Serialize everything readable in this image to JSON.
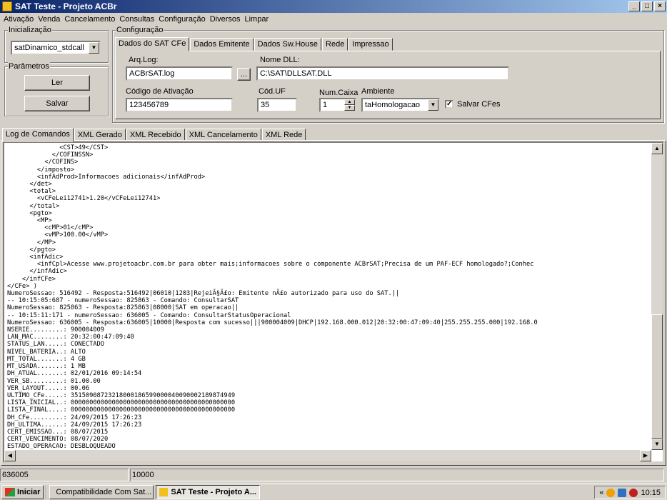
{
  "window": {
    "title": "SAT Teste - Projeto ACBr",
    "controls": [
      "_",
      "□",
      "×"
    ]
  },
  "menu": [
    "Ativação",
    "Venda",
    "Cancelamento",
    "Consultas",
    "Configuração",
    "Diversos",
    "Limpar"
  ],
  "inicializacao": {
    "legend": "Inicialização",
    "combo_value": "satDinamico_stdcall"
  },
  "parametros": {
    "legend": "Parâmetros",
    "ler_label": "Ler",
    "salvar_label": "Salvar"
  },
  "configuracao": {
    "legend": "Configuração",
    "tabs": [
      "Dados do SAT CFe",
      "Dados Emitente",
      "Dados Sw.House",
      "Rede",
      "Impressao"
    ],
    "arq_log_label": "Arq.Log:",
    "arq_log_value": "ACBrSAT.log",
    "browse_label": "...",
    "nome_dll_label": "Nome DLL:",
    "nome_dll_value": "C:\\SAT\\DLLSAT.DLL",
    "codigo_ativacao_label": "Código de Ativação",
    "codigo_ativacao_value": "123456789",
    "cod_uf_label": "Cód.UF",
    "cod_uf_value": "35",
    "num_caixa_label": "Num.Caixa",
    "num_caixa_value": "1",
    "ambiente_label": "Ambiente",
    "ambiente_value": "taHomologacao",
    "salvar_cfes_label": "Salvar CFes",
    "salvar_cfes_checked": "✓"
  },
  "log_tabs": [
    "Log de Comandos",
    "XML Gerado",
    "XML Recebido",
    "XML Cancelamento",
    "XML Rede"
  ],
  "log_text": "              <CST>49</CST>\n            </COFINSSN>\n          </COFINS>\n        </imposto>\n        <infAdProd>Informacoes adicionais</infAdProd>\n      </det>\n      <total>\n        <vCFeLei12741>1.20</vCFeLei12741>\n      </total>\n      <pgto>\n        <MP>\n          <cMP>01</cMP>\n          <vMP>100.00</vMP>\n        </MP>\n      </pgto>\n      <infAdic>\n        <infCpl>Acesse www.projetoacbr.com.br para obter mais;informacoes sobre o componente ACBrSAT;Precisa de um PAF-ECF homologado?;Conhec\n      </infAdic>\n    </infCFe>\n</CFe> )\nNumeroSessao: 516492 - Resposta:516492|06010|1203|RejeiÃ§Ã£o: Emitente nÃ£o autorizado para uso do SAT.||\n-- 10:15:05:687 - numeroSessao: 825863 - Comando: ConsultarSAT\nNumeroSessao: 825863 - Resposta:825863|08000|SAT em operacao||\n-- 10:15:11:171 - numeroSessao: 636005 - Comando: ConsultarStatusOperacional\nNumeroSessao: 636005 - Resposta:636005|10000|Resposta com sucesso|||900004009|DHCP|192.168.000.012|20:32:00:47:09:40|255.255.255.000|192.168.0\nNSERIE.........: 900004009\nLAN_MAC........: 20:32:00:47:09:40\nSTATUS_LAN.....: CONECTADO\nNIVEL_BATERIA..: ALTO\nMT_TOTAL.......: 4 GB\nMT_USADA.......: 1 MB\nDH_ATUAL.......: 02/01/2016 09:14:54\nVER_SB.........: 01.00.00\nVER_LAYOUT.....: 00.06\nULTIMO_CFe.....: 35150908723218000186599000040090002189874949\nLISTA_INICIAL..: 00000000000000000000000000000000000000000000\nLISTA_FINAL....: 00000000000000000000000000000000000000000000\nDH_CFe.........: 24/09/2015 17:26:23\nDH_ULTIMA......: 24/09/2015 17:26:23\nCERT_EMISSAO...: 08/07/2015\nCERT_VENCIMENTO: 08/07/2020\nESTADO_OPERACAO: DESBLOQUEADO",
  "status": {
    "panel1": "636005",
    "panel2": "10000"
  },
  "taskbar": {
    "start_label": "Iniciar",
    "tasks": [
      "Compatibilidade Com Sat...",
      "SAT Teste - Projeto A..."
    ],
    "tray_chevron": "«",
    "clock": "10:15"
  },
  "colors": {
    "titlebar_start": "#0a246a",
    "titlebar_end": "#a6caf0",
    "face": "#d4d0c8"
  }
}
